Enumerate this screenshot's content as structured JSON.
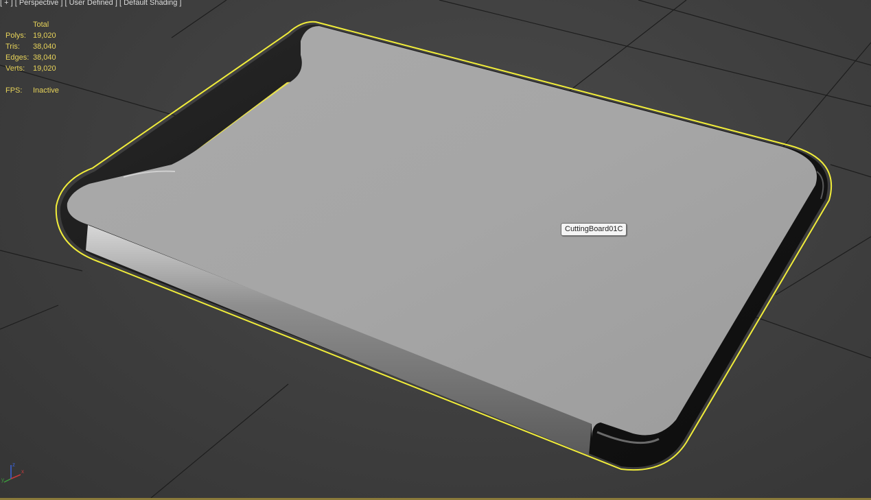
{
  "viewport": {
    "labels": [
      "[ + ]",
      "[ Perspective ]",
      "[ User Defined ]",
      "[ Default Shading ]"
    ]
  },
  "stats": {
    "header": "Total",
    "rows": [
      {
        "key": "Polys:",
        "value": "19,020"
      },
      {
        "key": "Tris:",
        "value": "38,040"
      },
      {
        "key": "Edges:",
        "value": "38,040"
      },
      {
        "key": "Verts:",
        "value": "19,020"
      }
    ],
    "fps_key": "FPS:",
    "fps_value": "Inactive"
  },
  "object_tooltip": "CuttingBoard01C",
  "axis": {
    "x": "x",
    "y": "y",
    "z": "z"
  },
  "colors": {
    "selection_outline": "#f2ee3a",
    "stats_text": "#e8d45a",
    "grid_lines": "#1e1e1e",
    "board_surface": "#a7a7a7",
    "board_rim": "#1a1a1a"
  }
}
